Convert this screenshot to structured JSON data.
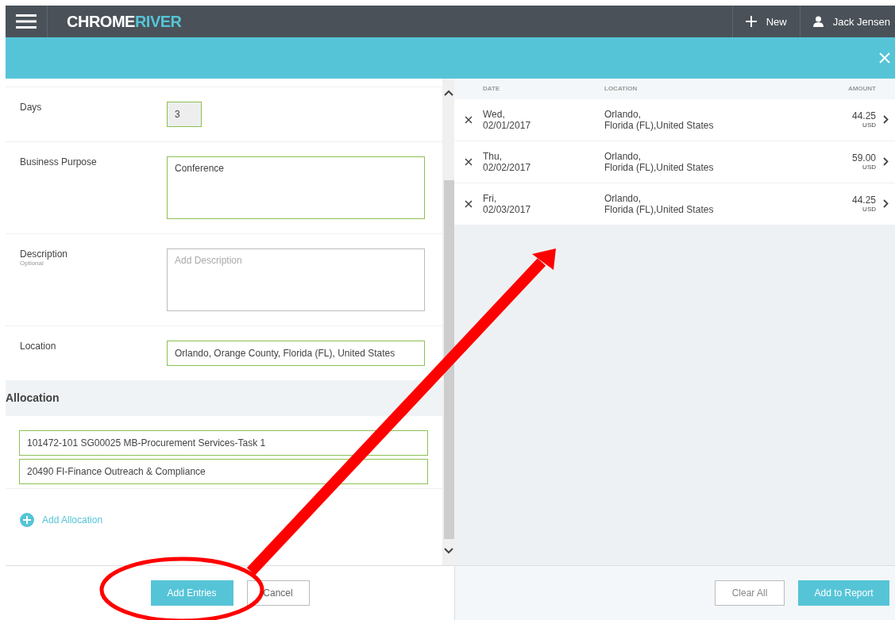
{
  "header": {
    "logo": {
      "part_1": "CHROME",
      "part_2": "RIVER"
    },
    "new_button": "New",
    "user": "Jack Jensen"
  },
  "form": {
    "fields": [
      {
        "label": "Days",
        "kind": "number",
        "value": "3"
      },
      {
        "label": "Business Purpose",
        "kind": "textarea",
        "value": "Conference"
      },
      {
        "label": "Description",
        "hint": "Optional",
        "kind": "textarea",
        "placeholder": "Add Description"
      },
      {
        "label": "Location",
        "kind": "text",
        "value": "Orlando, Orange County, Florida (FL), United States"
      }
    ],
    "allocation": {
      "title": "Allocation",
      "items": [
        "101472-101 SG00025 MB-Procurement Services-Task 1",
        "20490 FI-Finance Outreach & Compliance"
      ],
      "add_link": "Add Allocation"
    },
    "buttons": [
      "Add Entries",
      "Cancel"
    ]
  },
  "entries": {
    "columns": [
      "DATE",
      "LOCATION",
      "AMOUNT"
    ],
    "rows": [
      {
        "day": "Wed,",
        "date": "02/01/2017",
        "city": "Orlando,",
        "region": "Florida (FL),United States",
        "amount": "44.25",
        "currency": "USD"
      },
      {
        "day": "Thu,",
        "date": "02/02/2017",
        "city": "Orlando,",
        "region": "Florida (FL),United States",
        "amount": "59.00",
        "currency": "USD"
      },
      {
        "day": "Fri,",
        "date": "02/03/2017",
        "city": "Orlando,",
        "region": "Florida (FL),United States",
        "amount": "44.25",
        "currency": "USD"
      }
    ],
    "buttons": [
      "Clear All",
      "Add to Report"
    ]
  }
}
